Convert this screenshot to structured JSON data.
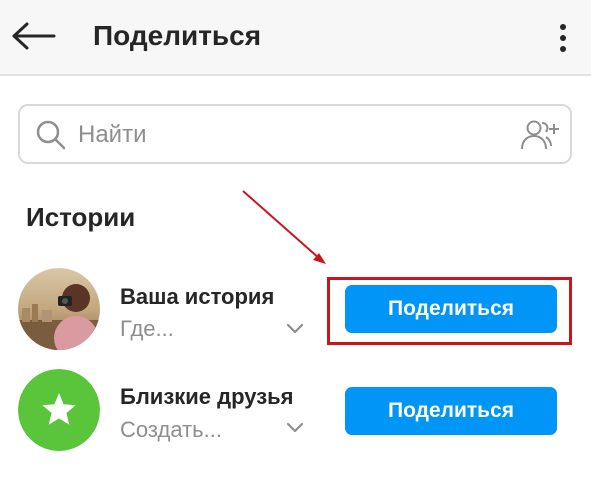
{
  "header": {
    "title": "Поделиться"
  },
  "search": {
    "placeholder": "Найти"
  },
  "section": {
    "title": "Истории"
  },
  "rows": [
    {
      "name": "Ваша история",
      "subtitle": "Где...",
      "button": "Поделиться"
    },
    {
      "name": "Близкие друзья",
      "subtitle": "Создать...",
      "button": "Поделиться"
    }
  ],
  "colors": {
    "accent": "#0095f6",
    "annotation": "#c8161d",
    "close_friends": "#5ac53a"
  }
}
